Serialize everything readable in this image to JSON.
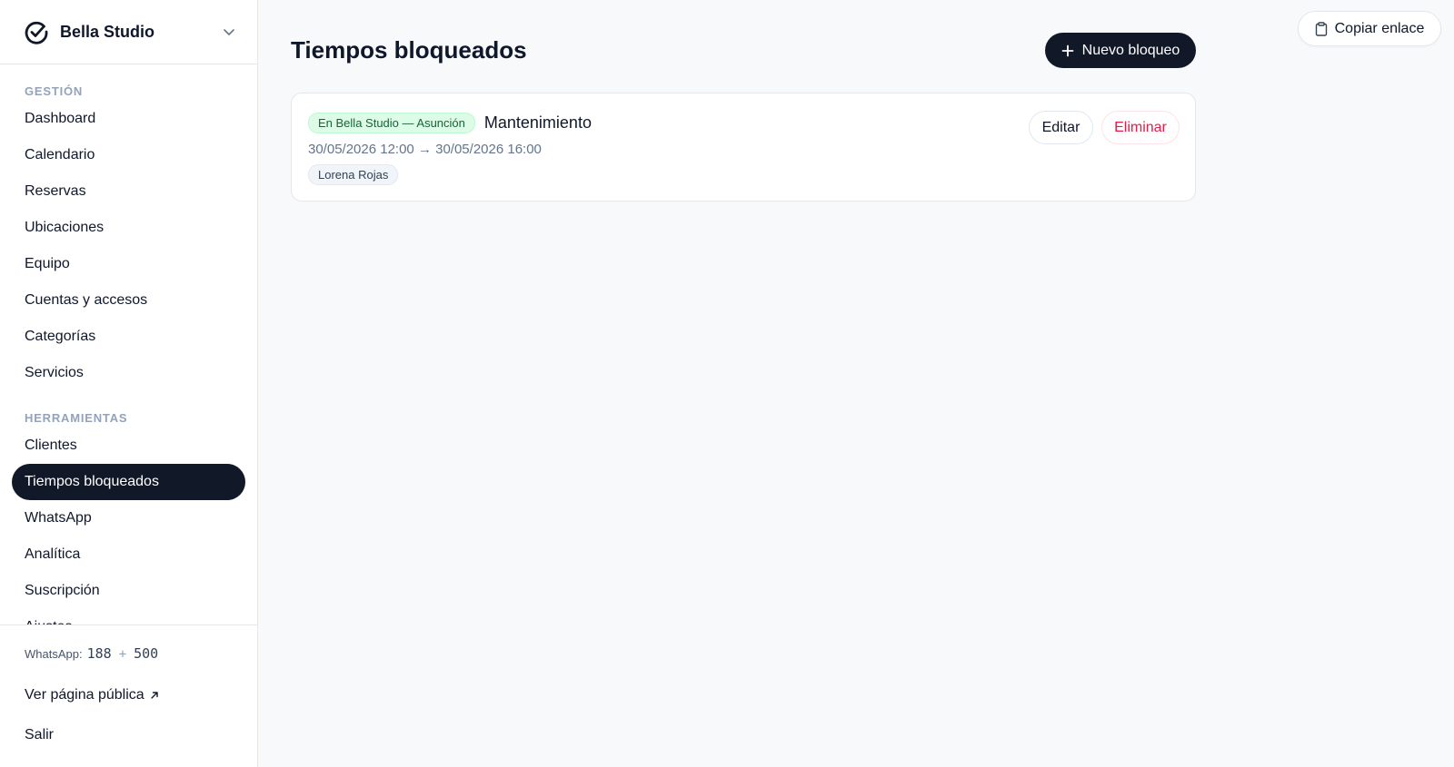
{
  "brand": {
    "name": "Bella Studio",
    "logo_icon": "check-circle-icon"
  },
  "nav": {
    "sections": [
      {
        "title": "GESTIÓN",
        "items": [
          "Dashboard",
          "Calendario",
          "Reservas",
          "Ubicaciones",
          "Equipo",
          "Cuentas y accesos",
          "Categorías",
          "Servicios"
        ]
      },
      {
        "title": "HERRAMIENTAS",
        "items": [
          "Clientes",
          "Tiempos bloqueados",
          "WhatsApp",
          "Analítica",
          "Suscripción",
          "Ajustes"
        ]
      }
    ],
    "active_item": "Tiempos bloqueados"
  },
  "footer": {
    "whatsapp_label": "WhatsApp:",
    "whatsapp_used": "188",
    "whatsapp_plus": "+",
    "whatsapp_extra": "500",
    "public_link": "Ver página pública",
    "logout": "Salir"
  },
  "header": {
    "title": "Tiempos bloqueados",
    "new_button": "Nuevo bloqueo",
    "copy_button": "Copiar enlace"
  },
  "blocks": [
    {
      "location": "En Bella Studio — Asunción",
      "reason": "Mantenimiento",
      "range": "30/05/2026 12:00 → 30/05/2026 16:00",
      "staff": "Lorena Rojas",
      "edit_label": "Editar",
      "delete_label": "Eliminar"
    }
  ],
  "colors": {
    "accent_dark": "#111827",
    "badge_green_bg": "#dcfce7",
    "badge_green_text": "#166534",
    "danger": "#e11d48"
  }
}
